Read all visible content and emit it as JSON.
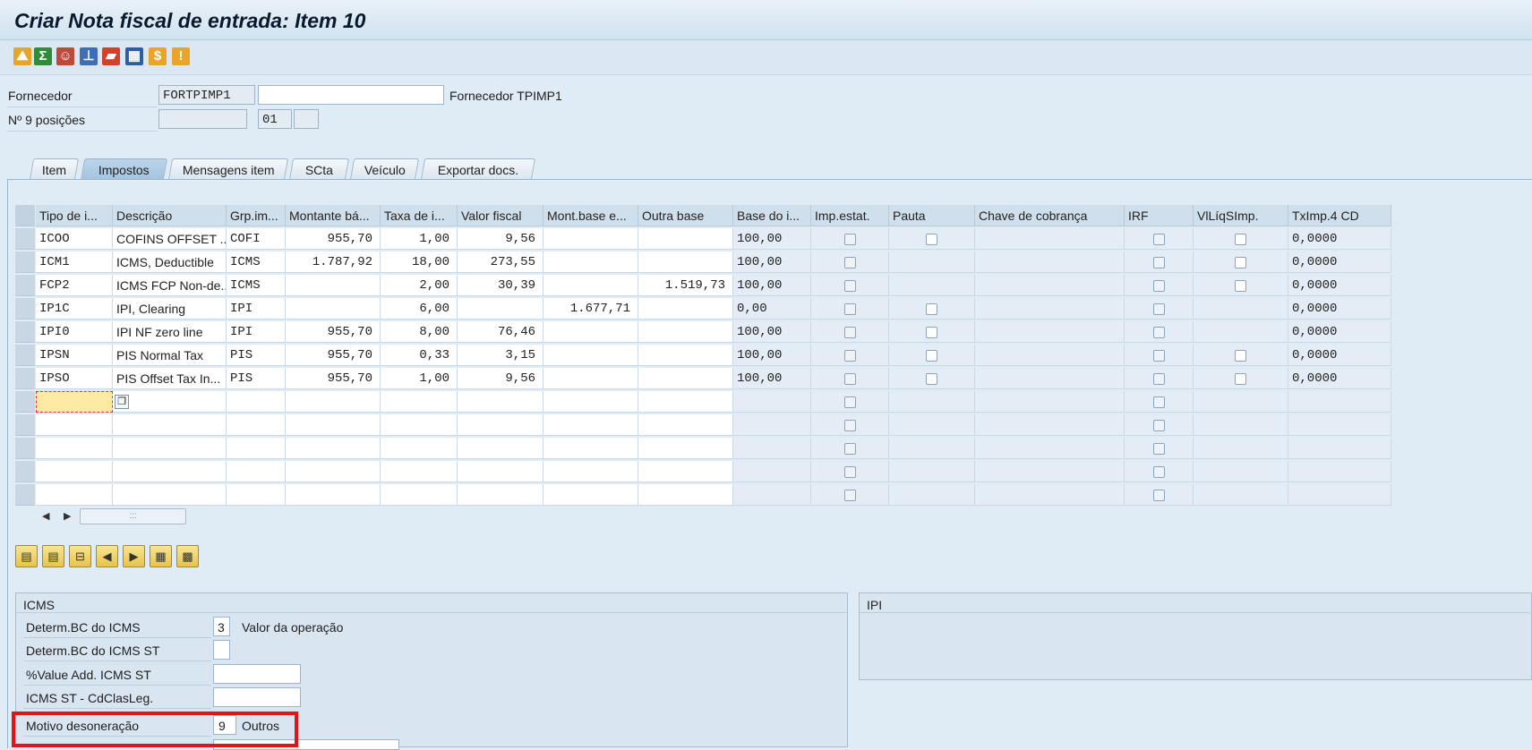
{
  "window": {
    "title": "Criar Nota fiscal de entrada: Item 10"
  },
  "toolbar": {
    "icons": [
      "partner-icon",
      "sum-icon",
      "users-icon",
      "stamp-icon",
      "truck-icon",
      "calculator-icon",
      "tax-icon",
      "message-icon"
    ]
  },
  "header": {
    "fornecedor_label": "Fornecedor",
    "fornecedor_value": "FORTPIMP1",
    "fornecedor_extra": "",
    "fornecedor_name": "Fornecedor TPIMP1",
    "posicoes_label": "Nº 9 posições",
    "posicoes_value": "",
    "posicoes_item": "01",
    "posicoes_sub": ""
  },
  "tabs": [
    {
      "label": "Item"
    },
    {
      "label": "Impostos"
    },
    {
      "label": "Mensagens item"
    },
    {
      "label": "SCta"
    },
    {
      "label": "Veículo"
    },
    {
      "label": "Exportar docs."
    }
  ],
  "active_tab": "Impostos",
  "table": {
    "columns": [
      "Tipo de i...",
      "Descrição",
      "Grp.im...",
      "Montante bá...",
      "Taxa de i...",
      "Valor fiscal",
      "Mont.base e...",
      "Outra base",
      "Base do i...",
      "Imp.estat.",
      "Pauta",
      "Chave de cobrança",
      "IRF",
      "VlLíqSImp.",
      "TxImp.4 CD"
    ],
    "rows": [
      [
        "ICOO",
        "COFINS OFFSET ...",
        "COFI",
        "955,70",
        "1,00",
        "9,56",
        "",
        "",
        "100,00",
        "",
        "",
        "",
        "",
        "",
        "0,0000"
      ],
      [
        "ICM1",
        "ICMS, Deductible",
        "ICMS",
        "1.787,92",
        "18,00",
        "273,55",
        "",
        "",
        "100,00",
        "",
        "",
        "",
        "",
        "",
        "0,0000"
      ],
      [
        "FCP2",
        "ICMS FCP Non-de...",
        "ICMS",
        "",
        "2,00",
        "30,39",
        "",
        "1.519,73",
        "100,00",
        "",
        "",
        "",
        "",
        "",
        "0,0000"
      ],
      [
        "IP1C",
        "IPI, Clearing",
        "IPI",
        "",
        "6,00",
        "",
        "1.677,71",
        "",
        "0,00",
        "",
        "",
        "",
        "",
        "",
        "0,0000"
      ],
      [
        "IPI0",
        "IPI NF zero line",
        "IPI",
        "955,70",
        "8,00",
        "76,46",
        "",
        "",
        "100,00",
        "",
        "",
        "",
        "",
        "",
        "0,0000"
      ],
      [
        "IPSN",
        "PIS Normal Tax",
        "PIS",
        "955,70",
        "0,33",
        "3,15",
        "",
        "",
        "100,00",
        "",
        "",
        "",
        "",
        "",
        "0,0000"
      ],
      [
        "IPSO",
        "PIS Offset Tax In...",
        "PIS",
        "955,70",
        "1,00",
        "9,56",
        "",
        "",
        "100,00",
        "",
        "",
        "",
        "",
        "",
        "0,0000"
      ]
    ]
  },
  "icms": {
    "title": "ICMS",
    "fields": [
      {
        "label": "Determ.BC do ICMS",
        "value": "3",
        "text": "Valor da operação"
      },
      {
        "label": "Determ.BC do ICMS ST",
        "value": "",
        "text": ""
      },
      {
        "label": "%Value Add. ICMS ST",
        "value": "",
        "text": ""
      },
      {
        "label": "ICMS ST - CdClasLeg.",
        "value": "",
        "text": ""
      },
      {
        "label": "Motivo desoneração",
        "value": "9",
        "text": "Outros"
      }
    ]
  },
  "ipi": {
    "title": "IPI"
  }
}
